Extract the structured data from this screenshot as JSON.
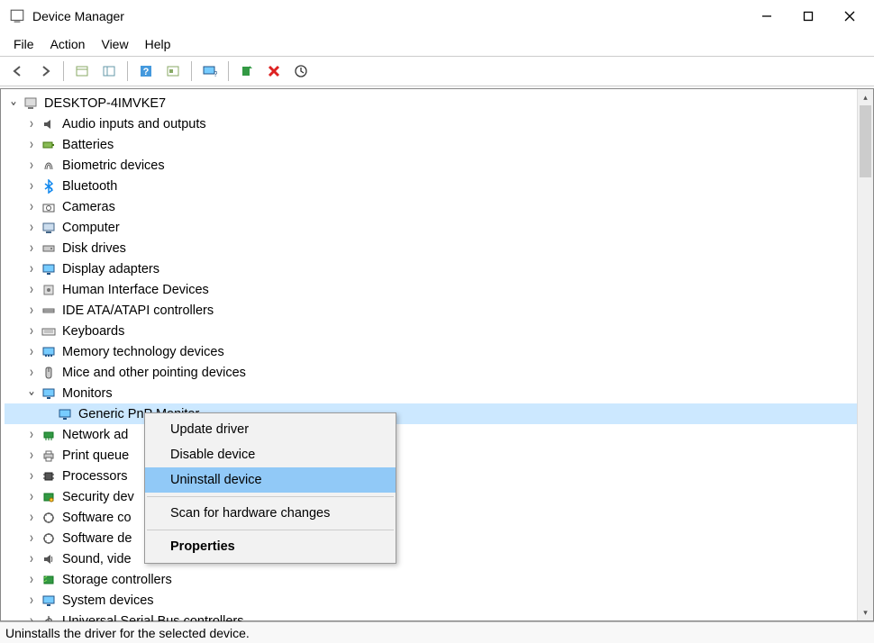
{
  "window": {
    "title": "Device Manager"
  },
  "menu": {
    "file": "File",
    "action": "Action",
    "view": "View",
    "help": "Help"
  },
  "toolbar_icons": [
    "back",
    "forward",
    "show-hidden",
    "tree-view",
    "help",
    "properties",
    "monitor-help",
    "update-driver",
    "uninstall",
    "scan"
  ],
  "tree": {
    "root": "DESKTOP-4IMVKE7",
    "categories": [
      {
        "label": "Audio inputs and outputs",
        "icon": "speaker-icon"
      },
      {
        "label": "Batteries",
        "icon": "battery-icon"
      },
      {
        "label": "Biometric devices",
        "icon": "fingerprint-icon"
      },
      {
        "label": "Bluetooth",
        "icon": "bluetooth-icon"
      },
      {
        "label": "Cameras",
        "icon": "camera-icon"
      },
      {
        "label": "Computer",
        "icon": "computer-icon"
      },
      {
        "label": "Disk drives",
        "icon": "disk-icon"
      },
      {
        "label": "Display adapters",
        "icon": "display-adapter-icon"
      },
      {
        "label": "Human Interface Devices",
        "icon": "hid-icon"
      },
      {
        "label": "IDE ATA/ATAPI controllers",
        "icon": "ide-icon"
      },
      {
        "label": "Keyboards",
        "icon": "keyboard-icon"
      },
      {
        "label": "Memory technology devices",
        "icon": "memory-icon"
      },
      {
        "label": "Mice and other pointing devices",
        "icon": "mouse-icon"
      },
      {
        "label": "Monitors",
        "icon": "monitor-icon",
        "expanded": true,
        "children": [
          {
            "label": "Generic PnP Monitor",
            "icon": "monitor-icon",
            "selected": true
          }
        ]
      },
      {
        "label": "Network adapters",
        "icon": "network-icon",
        "truncated": "Network ad"
      },
      {
        "label": "Print queues",
        "icon": "printer-icon",
        "truncated": "Print queue"
      },
      {
        "label": "Processors",
        "icon": "cpu-icon"
      },
      {
        "label": "Security devices",
        "icon": "security-icon",
        "truncated": "Security dev"
      },
      {
        "label": "Software components",
        "icon": "software-icon",
        "truncated": "Software co"
      },
      {
        "label": "Software devices",
        "icon": "software-icon",
        "truncated": "Software de"
      },
      {
        "label": "Sound, video and game controllers",
        "icon": "sound-icon",
        "truncated": "Sound, vide"
      },
      {
        "label": "Storage controllers",
        "icon": "storage-icon"
      },
      {
        "label": "System devices",
        "icon": "system-icon"
      },
      {
        "label": "Universal Serial Bus controllers",
        "icon": "usb-icon",
        "truncated": "Universal Serial Bus controllers"
      }
    ]
  },
  "context_menu": {
    "update": "Update driver",
    "disable": "Disable device",
    "uninstall": "Uninstall device",
    "scan": "Scan for hardware changes",
    "properties": "Properties"
  },
  "status": "Uninstalls the driver for the selected device."
}
